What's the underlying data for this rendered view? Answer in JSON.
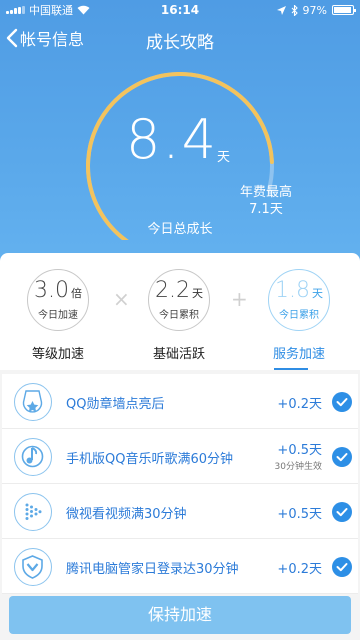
{
  "status_bar": {
    "carrier": "中国联通",
    "time": "16:14",
    "battery": "97%",
    "battery_level": 0.97
  },
  "nav": {
    "back_label": "帐号信息",
    "title": "成长攻略"
  },
  "hero": {
    "value": "8.4",
    "unit": "天",
    "annual_label": "年费最高",
    "annual_value": "7.1天",
    "today_label": "今日总成长",
    "gauge_progress": 0.93,
    "colors": {
      "arc": "#f3c35d",
      "arc_track": "#8fc3ef",
      "background": "#56a4e8"
    }
  },
  "stats": [
    {
      "value": "3.0",
      "unit": "倍",
      "sub": "今日加速",
      "label": "等级加速",
      "active": false
    },
    {
      "value": "2.2",
      "unit": "天",
      "sub": "今日累积",
      "label": "基础活跃",
      "active": false
    },
    {
      "value": "1.8",
      "unit": "天",
      "sub": "今日累积",
      "label": "服务加速",
      "active": true
    }
  ],
  "operators": [
    "×",
    "+"
  ],
  "services": [
    {
      "icon": "medal-icon",
      "text": "QQ勋章墙点亮后",
      "points": "+0.2天",
      "note": ""
    },
    {
      "icon": "music-note-icon",
      "text": "手机版QQ音乐听歌满60分钟",
      "points": "+0.5天",
      "note": "30分钟生效"
    },
    {
      "icon": "video-play-icon",
      "text": "微视看视频满30分钟",
      "points": "+0.5天",
      "note": ""
    },
    {
      "icon": "shield-icon",
      "text": "腾讯电脑管家日登录达30分钟",
      "points": "+0.2天",
      "note": ""
    }
  ],
  "action": {
    "label": "保持加速",
    "color": "#7fc2f0"
  }
}
